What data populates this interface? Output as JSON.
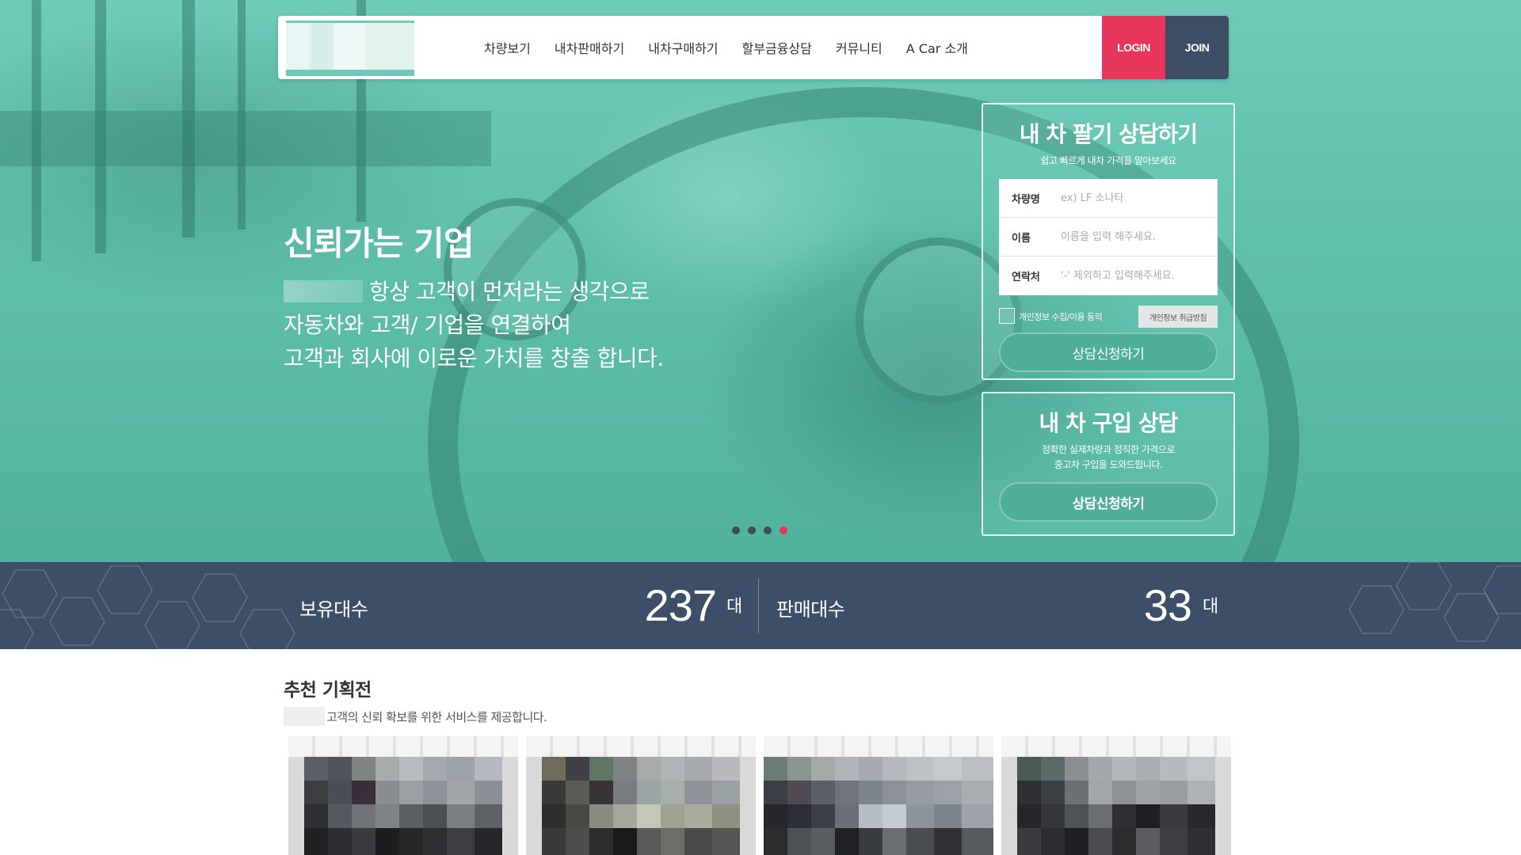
{
  "nav": {
    "items": [
      "차량보기",
      "내차판매하기",
      "내차구매하기",
      "할부금융상담",
      "커뮤니티",
      "A Car 소개"
    ],
    "login_label": "LOGIN",
    "join_label": "JOIN"
  },
  "hero": {
    "title": "신뢰가는 기업",
    "lines": [
      "항상 고객이 먼저라는 생각으로",
      "자동차와 고객/ 기업을 연결하여",
      "고객과 회사에 이로운 가치를 창출 합니다."
    ],
    "slides": {
      "total": 4,
      "active": 4
    }
  },
  "sell_panel": {
    "title": "내 차 팔기 상담하기",
    "subtitle": "쉽고 빠르게 내차 가격을 알아보세요",
    "fields": [
      {
        "label": "차량명",
        "placeholder": "ex) LF 소나타",
        "value": ""
      },
      {
        "label": "이름",
        "placeholder": "이름을 입력 해주세요.",
        "value": ""
      },
      {
        "label": "연락처",
        "placeholder": "'-' 제외하고 입력해주세요.",
        "value": ""
      }
    ],
    "agree_label": "개인정보 수집/이용 동의",
    "agree_checked": false,
    "policy_button": "개인정보 취급방침",
    "submit_label": "상담신청하기"
  },
  "buy_panel": {
    "title": "내 차 구입 상담",
    "subtitle_lines": [
      "정확한 실제차량과 정직한 가격으로",
      "중고차 구입을 도와드립니다."
    ],
    "submit_label": "상담신청하기"
  },
  "stats": {
    "owned_label": "보유대수",
    "owned_value": "237",
    "owned_unit": "대",
    "sold_label": "판매대수",
    "sold_value": "33",
    "sold_unit": "대"
  },
  "recommend": {
    "title": "추천 기획전",
    "subtitle": "고객의 신뢰 확보를 위한 서비스를 제공합니다."
  },
  "colors": {
    "hero_teal": "#5fc0ab",
    "login_red": "#e8365a",
    "navy": "#3d4f68",
    "button_teal": "#4fae98"
  }
}
